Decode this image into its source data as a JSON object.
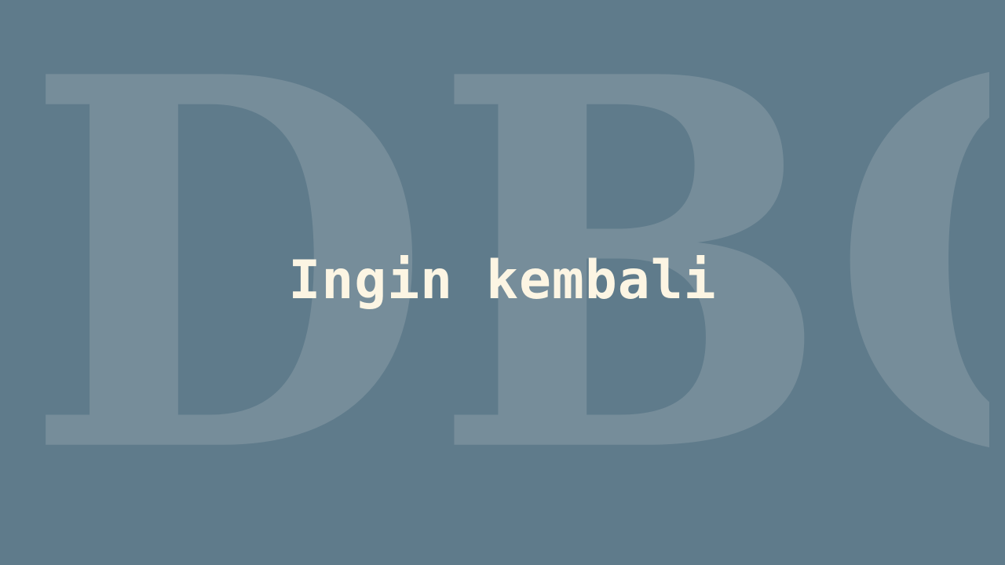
{
  "watermark": {
    "text": "DBC",
    "letters": [
      "D",
      "B",
      "C"
    ],
    "color": "#768d9a"
  },
  "title": {
    "text": "Ingin kembali",
    "color": "#fcf5e3"
  },
  "background_color": "#5f7b8b"
}
